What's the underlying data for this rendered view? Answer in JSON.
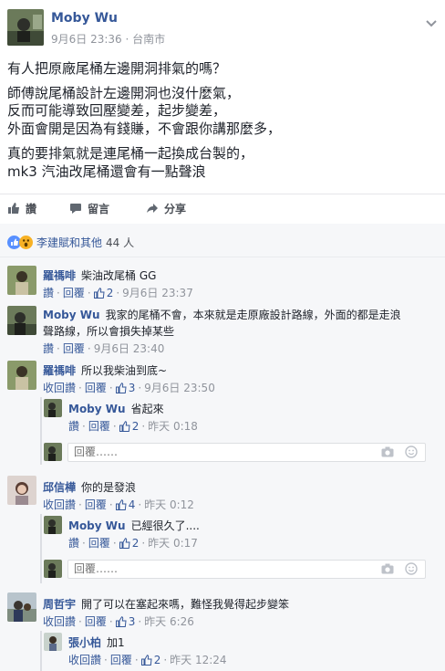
{
  "post": {
    "author": "Moby Wu",
    "time": "9月6日 23:36",
    "location": "台南市",
    "lines": [
      "有人把原廠尾桶左邊開洞排氣的嗎？",
      "師傅說尾桶設計左邊開洞也沒什麼氣，",
      "反而可能導致回壓變差，起步變差，",
      "外面會開是因為有錢賺，不會跟你講那麼多，",
      "真的要排氣就是連尾桶一起換成台製的，",
      "mk3 汽油改尾桶還會有一點聲浪"
    ],
    "actions": {
      "like": "讚",
      "comment": "留言",
      "share": "分享"
    }
  },
  "reactions": {
    "names": "李建賦和其他",
    "count": "44 人"
  },
  "labels": {
    "like": "讚",
    "reply": "回覆",
    "unlike": "收回讚",
    "reply_placeholder": "回覆……"
  },
  "comments": [
    {
      "name": "羅禡啡",
      "text": "柴油改尾桶 GG",
      "like_label": "讚",
      "likes": "2",
      "time": "9月6日 23:37"
    },
    {
      "name": "Moby Wu",
      "text_line1": "我家的尾桶不會，本來就是走原廠設計路線，外面的都是走浪",
      "text_line2": "聲路線，所以會損失掉某些",
      "like_label": "讚",
      "likes": "",
      "time": "9月6日 23:40"
    },
    {
      "name": "羅禡啡",
      "text": "所以我柴油到底~",
      "like_label": "收回讚",
      "likes": "3",
      "time": "9月6日 23:50",
      "replies": [
        {
          "name": "Moby Wu",
          "text": "省起來",
          "like_label": "讚",
          "likes": "2",
          "time": "昨天 0:18"
        }
      ]
    },
    {
      "name": "邱信樺",
      "text": "你的是發浪",
      "like_label": "收回讚",
      "likes": "4",
      "time": "昨天 0:12",
      "replies": [
        {
          "name": "Moby Wu",
          "text": "已經很久了....",
          "like_label": "讚",
          "likes": "2",
          "time": "昨天 0:17"
        }
      ]
    },
    {
      "name": "周哲宇",
      "text": "開了可以在塞起來嗎，難怪我覺得起步變笨",
      "like_label": "收回讚",
      "likes": "3",
      "time": "昨天 6:26",
      "replies": [
        {
          "name": "張小柏",
          "text": "加1",
          "like_label": "收回讚",
          "likes": "2",
          "time": "昨天 12:24"
        }
      ]
    }
  ],
  "colors": {
    "link": "#365899",
    "text": "#1d2129",
    "meta": "#90949c",
    "bg": "#f6f7f9",
    "like_blue": "#5890ff",
    "wow_yellow": "#f7b125"
  }
}
